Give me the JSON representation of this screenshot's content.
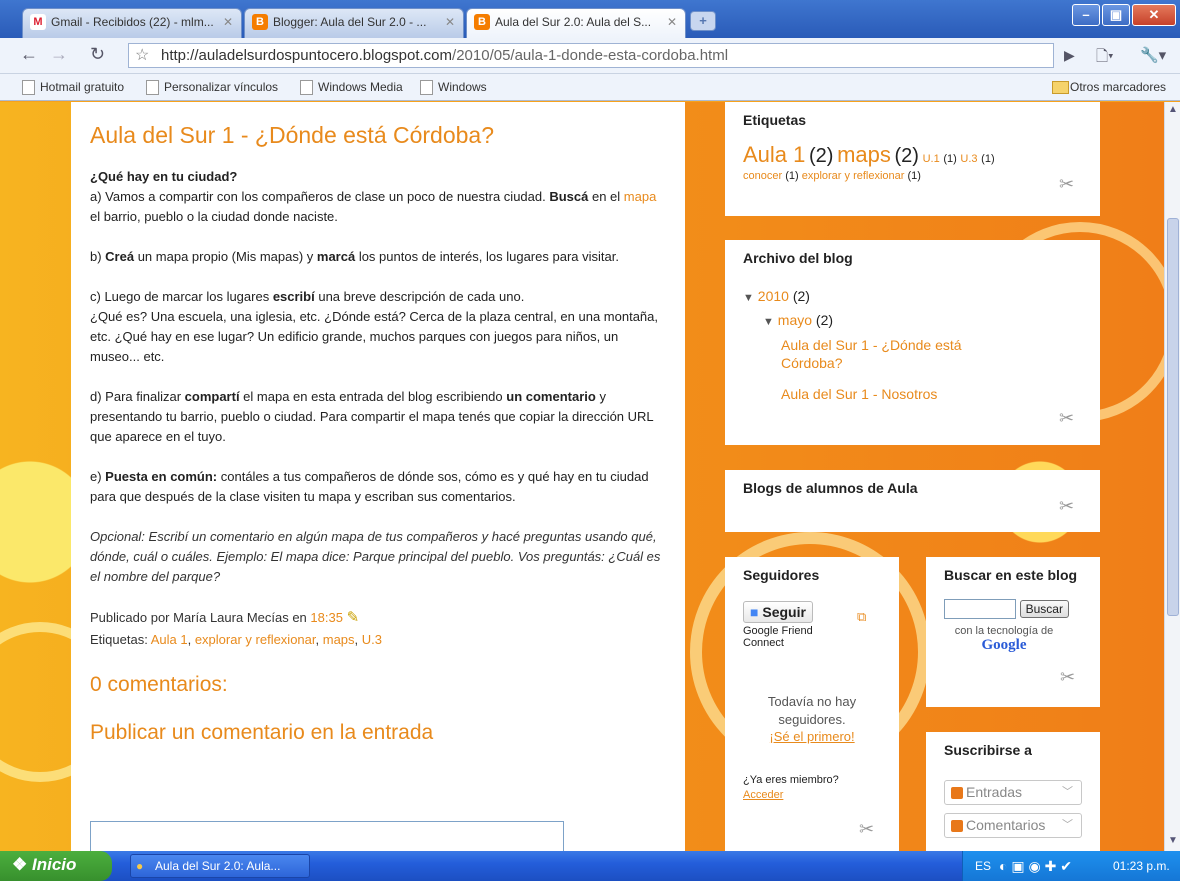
{
  "browser": {
    "tabs": [
      {
        "label": "Gmail - Recibidos (22) - mlm...",
        "icon": "gmail-icon"
      },
      {
        "label": "Blogger: Aula del Sur 2.0 - ...",
        "icon": "blogger-icon"
      },
      {
        "label": "Aula del Sur 2.0: Aula del S...",
        "icon": "blogger-icon"
      }
    ],
    "url_host": "http://auladelsurdospuntocero.blogspot.com",
    "url_path": "/2010/05/aula-1-donde-esta-cordoba.html",
    "bookmarks": [
      "Hotmail gratuito",
      "Personalizar vínculos",
      "Windows Media",
      "Windows"
    ],
    "other_bookmarks": "Otros marcadores"
  },
  "post": {
    "title": "Aula del Sur 1 - ¿Dónde está Córdoba?",
    "q_heading": "¿Qué hay en tu ciudad?",
    "a_1": "a) Vamos a compartir con los compañeros de clase un poco de nuestra ciudad. ",
    "a_bold": "Buscá",
    "a_2": " en el ",
    "a_link": "mapa",
    "a_3": " el barrio, pueblo o la ciudad donde naciste.",
    "b_1": "b) ",
    "b_bold1": "Creá",
    "b_2": " un mapa propio (Mis mapas) y ",
    "b_bold2": "marcá",
    "b_3": " los puntos de interés, los lugares para visitar.",
    "c_1": "c) Luego de marcar los lugares ",
    "c_bold": "escribí",
    "c_2": " una breve descripción de cada uno.",
    "c_3": "¿Qué es? Una escuela, una iglesia, etc. ¿Dónde está? Cerca de la plaza central, en una montaña, etc. ¿Qué hay en ese lugar? Un edificio grande, muchos parques con juegos para niños, un museo... etc.",
    "d_1": "d) Para finalizar ",
    "d_bold1": "compartí",
    "d_2": " el mapa en esta entrada del blog escribiendo ",
    "d_bold2": "un comentario",
    "d_3": " y presentando tu barrio, pueblo o ciudad. Para compartir el mapa tenés que copiar la dirección URL que aparece en el tuyo.",
    "e_1": "e) ",
    "e_bold": "Puesta en común:",
    "e_2": " contáles a tus compañeros de dónde sos, cómo es y qué hay en tu ciudad para que después de la clase visiten tu mapa y escriban sus comentarios.",
    "optional": "Opcional: Escribí un comentario en algún mapa de tus compañeros y hacé preguntas usando qué, dónde, cuál o cuáles. Ejemplo: El mapa dice: Parque principal del pueblo. Vos preguntás: ¿Cuál es el nombre del parque?",
    "published_by": "Publicado por María Laura Mecías en ",
    "time": "18:35",
    "labels_prefix": "Etiquetas: ",
    "labels": [
      "Aula 1",
      "explorar y reflexionar",
      "maps",
      "U.3"
    ],
    "comments_count": "0 comentarios:",
    "post_comment": "Publicar un comentario en la entrada"
  },
  "sidebar": {
    "etiquetas": {
      "title": "Etiquetas",
      "big": [
        {
          "label": "Aula 1",
          "count": "(2)"
        },
        {
          "label": "maps",
          "count": "(2)"
        }
      ],
      "small": [
        {
          "label": "U.1",
          "count": "(1)"
        },
        {
          "label": "U.3",
          "count": "(1)"
        }
      ],
      "row2": [
        {
          "label": "conocer",
          "count": "(1)"
        },
        {
          "label": "explorar y reflexionar",
          "count": "(1)"
        }
      ]
    },
    "archivo": {
      "title": "Archivo del blog",
      "year": "2010",
      "year_count": "(2)",
      "month": "mayo",
      "month_count": "(2)",
      "posts": [
        "Aula del Sur 1 - ¿Dónde está Córdoba?",
        "Aula del Sur 1 - Nosotros"
      ]
    },
    "blogs_alumnos": {
      "title": "Blogs de alumnos de Aula"
    },
    "seguidores": {
      "title": "Seguidores",
      "follow_btn": "Seguir",
      "gfc": "Google Friend Connect",
      "none": "Todavía no hay seguidores.",
      "first": "¡Sé el primero!",
      "member": "¿Ya eres miembro?",
      "login": "Acceder"
    },
    "buscar": {
      "title": "Buscar en este blog",
      "button": "Buscar",
      "powered": "con la tecnología de",
      "google": "Google"
    },
    "suscribirse": {
      "title": "Suscribirse a",
      "options": [
        "Entradas",
        "Comentarios"
      ]
    }
  },
  "taskbar": {
    "start": "Inicio",
    "window": "Aula del Sur 2.0: Aula...",
    "lang": "ES",
    "clock": "01:23 p.m."
  },
  "colors": {
    "accent": "#e88a1c",
    "chrome_blue": "#2a5bb8",
    "taskbar": "#245edb"
  }
}
